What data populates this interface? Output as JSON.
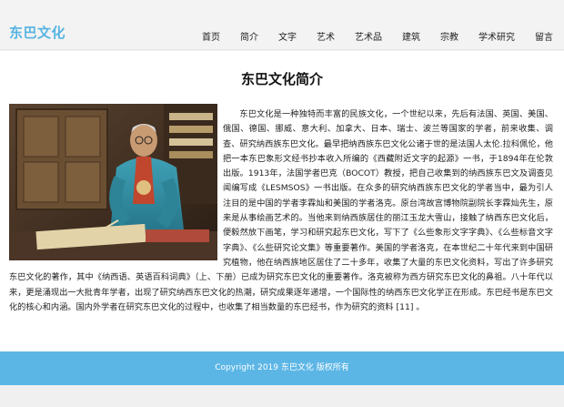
{
  "header": {
    "logo": "东巴文化",
    "nav": [
      "首页",
      "简介",
      "文字",
      "艺术",
      "艺术品",
      "建筑",
      "宗教",
      "学术研究",
      "留言"
    ]
  },
  "main": {
    "title": "东巴文化简介",
    "paragraph": "东巴文化是一种独特而丰富的民族文化，一个世纪以来，先后有法国、英国、美国、俄国、德国、挪威、意大利、加拿大、日本、瑞士、波兰等国家的学者，前来收集、调查、研究纳西族东巴文化。最早把纳西族东巴文化公诸于世的是法国人太伦.拉科佩伦，他把一本东巴象形文经书抄本收入所编的《西藏附近文字的起源》一书，于1894年在伦敦出版。1913年，法国学者巴克（BOCOT）教授，把自己收集到的纳西族东巴文及调查见闻编写成《LESMSOS》一书出版。在众多的研究纳西族东巴文化的学者当中，最为引人注目的是中国的学者李霖灿和美国的学者洛克。原台湾故宫博物院副院长李霖灿先生，原来是从事绘画艺术的。当他来到纳西族居住的丽江玉龙大雪山，接触了纳西东巴文化后，便毅然放下画笔，学习和研究起东巴文化，写下了《么些象形文字字典》、《么些标音文字字典》、《么些研究论文集》等重要著作。美国的学者洛克，在本世纪二十年代来到中国研究植物，他在纳西族地区居住了二十多年，收集了大量的东巴文化资料，写出了许多研究东巴文化的著作，其中《纳西语、英语百科词典》（上、下册）已成为研究东巴文化的重要著作。洛克被称为西方研究东巴文化的鼻祖。八十年代以来，更是涌现出一大批青年学者，出现了研究纳西东巴文化的热潮，研究成果逐年递增，一个国际性的纳西东巴文化学正在形成。东巴经书是东巴文化的核心和内涵。国内外学者在研究东巴文化的过程中，也收集了相当数量的东巴经书，作为研究的资料 [11] 。"
  },
  "footer": {
    "copyright": "Copyright 2019 东巴文化 版权所有"
  },
  "colors": {
    "accent": "#56b4e2",
    "footer_bg": "#5cb6e5"
  }
}
